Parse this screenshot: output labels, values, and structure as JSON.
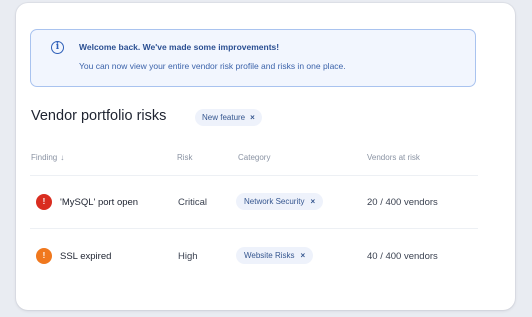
{
  "alert": {
    "icon": "info-icon",
    "icon_glyph": "i",
    "title": "Welcome back. We've made some improvements!",
    "body": "You can now view your entire vendor risk profile and risks in one place."
  },
  "section": {
    "title": "Vendor portfolio risks",
    "badge": "New feature",
    "badge_close": "×"
  },
  "table": {
    "headers": {
      "finding": "Finding",
      "finding_sort": "↓",
      "risk": "Risk",
      "category": "Category",
      "vendors": "Vendors at risk"
    },
    "rows": [
      {
        "finding": "'MySQL' port open",
        "icon": "critical-risk-icon",
        "icon_glyph": "!",
        "icon_color": "#d92d20",
        "risk": "Critical",
        "category": "Network Security",
        "category_close": "×",
        "vendors": "20 / 400 vendors"
      },
      {
        "finding": "SSL expired",
        "icon": "high-risk-icon",
        "icon_glyph": "!",
        "icon_color": "#f0781e",
        "risk": "High",
        "category": "Website Risks",
        "category_close": "×",
        "vendors": "40 / 400 vendors"
      }
    ]
  },
  "colors": {
    "accent": "#2e5fb8",
    "critical": "#d92d20",
    "high": "#f0781e"
  }
}
